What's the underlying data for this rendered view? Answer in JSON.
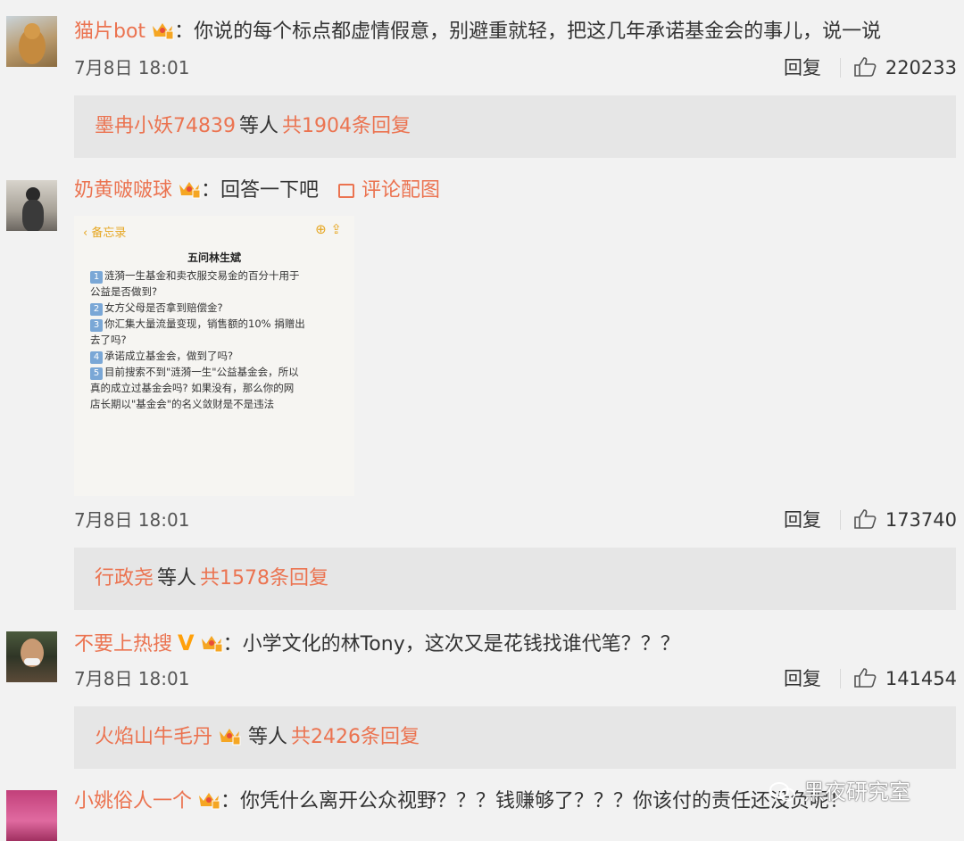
{
  "comments": [
    {
      "username": "猫片bot",
      "text": "：你说的每个标点都虚情假意，别避重就轻，把这几年承诺基金会的事儿，说一说",
      "date": "7月8日 18:01",
      "reply_label": "回复",
      "likes": "220233",
      "reply_summary": {
        "user": "墨冉小妖74839",
        "and_others": "等人",
        "total": "共1904条回复"
      }
    },
    {
      "username": "奶黄啵啵球",
      "text": "：回答一下吧",
      "picture_link": "评论配图",
      "date": "7月8日 18:01",
      "reply_label": "回复",
      "likes": "173740",
      "reply_summary": {
        "user": "行政尧",
        "and_others": "等人",
        "total": "共1578条回复"
      },
      "memo_image": {
        "back_label": "备忘录",
        "title": "五问林生斌",
        "lines": [
          {
            "num": "1",
            "text": "涟漪一生基金和卖衣服交易金的百分十用于"
          },
          {
            "num": "",
            "text": "公益是否做到?"
          },
          {
            "num": "2",
            "text": "女方父母是否拿到赔偿金?"
          },
          {
            "num": "3",
            "text": "你汇集大量流量变现，销售额的10% 捐赠出"
          },
          {
            "num": "",
            "text": "去了吗?"
          },
          {
            "num": "4",
            "text": "承诺成立基金会，做到了吗?"
          },
          {
            "num": "5",
            "text": "目前搜索不到\"涟漪一生\"公益基金会，所以"
          },
          {
            "num": "",
            "text": "真的成立过基金会吗? 如果没有，那么你的网"
          },
          {
            "num": "",
            "text": "店长期以\"基金会\"的名义敛财是不是违法"
          }
        ]
      }
    },
    {
      "username": "不要上热搜",
      "verified_mark": "V",
      "text": "：小学文化的林Tony，这次又是花钱找谁代笔？？？",
      "date": "7月8日 18:01",
      "reply_label": "回复",
      "likes": "141454",
      "reply_summary": {
        "user": "火焰山牛毛丹",
        "and_others": "等人",
        "total": "共2426条回复"
      }
    },
    {
      "username": "小姚俗人一个",
      "text": "：你凭什么离开公众视野？？？钱赚够了？？？你该付的责任还没负呢！"
    }
  ],
  "watermark": "黑夜研究室",
  "colors": {
    "accent": "#eb7350",
    "background": "#f2f2f2",
    "reply_box": "#e6e6e6"
  }
}
